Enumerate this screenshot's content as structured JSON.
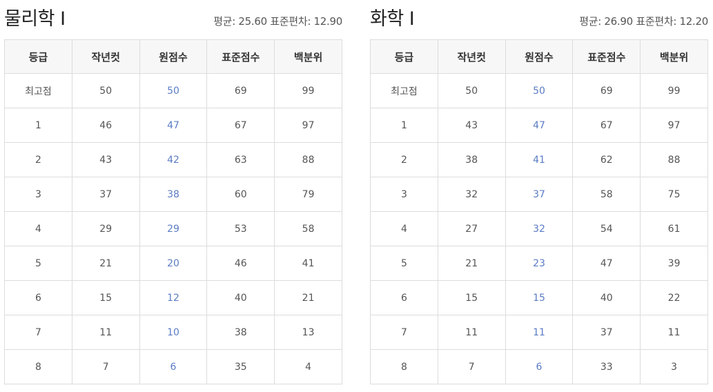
{
  "panels": [
    {
      "title": "물리학 Ⅰ",
      "stats": "평균: 25.60 표준편차: 12.90",
      "headers": [
        "등급",
        "작년컷",
        "원점수",
        "표준점수",
        "백분위"
      ],
      "rows": [
        [
          "최고점",
          "50",
          "50",
          "69",
          "99"
        ],
        [
          "1",
          "46",
          "47",
          "67",
          "97"
        ],
        [
          "2",
          "43",
          "42",
          "63",
          "88"
        ],
        [
          "3",
          "37",
          "38",
          "60",
          "79"
        ],
        [
          "4",
          "29",
          "29",
          "53",
          "58"
        ],
        [
          "5",
          "21",
          "20",
          "46",
          "41"
        ],
        [
          "6",
          "15",
          "12",
          "40",
          "21"
        ],
        [
          "7",
          "11",
          "10",
          "38",
          "13"
        ],
        [
          "8",
          "7",
          "6",
          "35",
          "4"
        ]
      ]
    },
    {
      "title": "화학 Ⅰ",
      "stats": "평균: 26.90 표준편차: 12.20",
      "headers": [
        "등급",
        "작년컷",
        "원점수",
        "표준점수",
        "백분위"
      ],
      "rows": [
        [
          "최고점",
          "50",
          "50",
          "69",
          "99"
        ],
        [
          "1",
          "43",
          "47",
          "67",
          "97"
        ],
        [
          "2",
          "38",
          "41",
          "62",
          "88"
        ],
        [
          "3",
          "32",
          "37",
          "58",
          "75"
        ],
        [
          "4",
          "27",
          "32",
          "54",
          "61"
        ],
        [
          "5",
          "21",
          "23",
          "47",
          "39"
        ],
        [
          "6",
          "15",
          "15",
          "40",
          "22"
        ],
        [
          "7",
          "11",
          "11",
          "37",
          "11"
        ],
        [
          "8",
          "7",
          "6",
          "33",
          "3"
        ]
      ]
    }
  ],
  "colors": {
    "raw_score_text": "#5b7cc4",
    "header_bg": "#f7f7f7",
    "border": "#dcdcdc"
  }
}
